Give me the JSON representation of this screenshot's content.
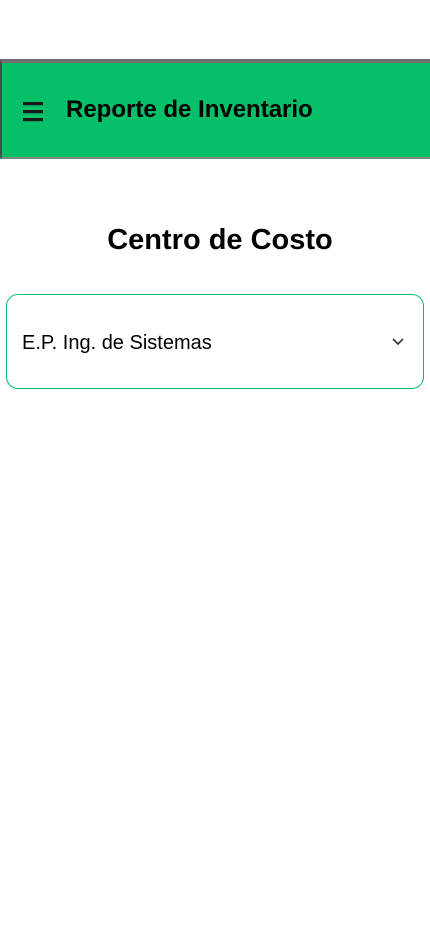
{
  "app_bar": {
    "title": "Reporte de Inventario",
    "menu_icon": "hamburger-menu-icon",
    "background_color": "#05bf69"
  },
  "main": {
    "section_title": "Centro de Costo",
    "cost_center_select": {
      "selected_value": "E.P. Ing. de Sistemas",
      "icon": "chevron-down-icon",
      "border_color": "#05bf69"
    }
  }
}
